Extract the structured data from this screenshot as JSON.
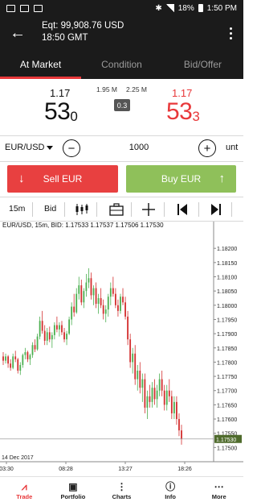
{
  "status_bar": {
    "battery": "18%",
    "time": "1:50 PM"
  },
  "account": {
    "equity": "Eqt: 99,908.76 USD",
    "time": "18:50 GMT"
  },
  "tabs": [
    {
      "label": "At Market",
      "active": true
    },
    {
      "label": "Condition",
      "active": false
    },
    {
      "label": "Bid/Offer",
      "active": false
    }
  ],
  "quote": {
    "bid_big": "1.17",
    "bid_pips": "53",
    "bid_fraction": "0",
    "ask_big": "1.17",
    "ask_pips": "53",
    "ask_fraction": "3",
    "bid_volume": "1.95 M",
    "ask_volume": "2.25 M",
    "spread": "0.3"
  },
  "order": {
    "symbol": "EUR/USD",
    "quantity": "1000",
    "unit": "unt",
    "minus": "−",
    "plus": "+"
  },
  "buttons": {
    "sell": "Sell EUR",
    "buy": "Buy EUR",
    "sell_arrow": "↓",
    "buy_arrow": "↑"
  },
  "toolbar": {
    "timeframe": "15m",
    "price_side": "Bid",
    "icons": [
      "candles-icon",
      "briefcase-icon",
      "crosshair-icon",
      "skip-back-icon",
      "skip-forward-icon"
    ]
  },
  "chart_data": {
    "type": "candlestick",
    "title": "EUR/USD, 15m, BID: 1.17533 1.17537 1.17506 1.17530",
    "ylim": [
      1.1745,
      1.1826
    ],
    "y_ticks": [
      "1.18200",
      "1.18150",
      "1.18100",
      "1.18050",
      "1.18000",
      "1.17950",
      "1.17900",
      "1.17850",
      "1.17800",
      "1.17750",
      "1.17700",
      "1.17650",
      "1.17600",
      "1.17550",
      "1.17500"
    ],
    "x_ticks": [
      "03:30",
      "08:28",
      "13:27",
      "18:26"
    ],
    "date_label": "14 Dec 2017",
    "last_price": "1.17530",
    "up_color": "#4caf50",
    "down_color": "#d32f2f",
    "candles": [
      [
        1.1782,
        1.17835,
        1.1779,
        1.17805
      ],
      [
        1.17805,
        1.1783,
        1.17795,
        1.1782
      ],
      [
        1.1782,
        1.17825,
        1.1778,
        1.17795
      ],
      [
        1.17795,
        1.1781,
        1.1777,
        1.1778
      ],
      [
        1.1778,
        1.1783,
        1.17775,
        1.1782
      ],
      [
        1.1782,
        1.1784,
        1.178,
        1.1781
      ],
      [
        1.1781,
        1.17815,
        1.1776,
        1.1777
      ],
      [
        1.1777,
        1.178,
        1.17755,
        1.1779
      ],
      [
        1.1779,
        1.1783,
        1.1778,
        1.17825
      ],
      [
        1.17825,
        1.1785,
        1.1781,
        1.17835
      ],
      [
        1.17835,
        1.1784,
        1.178,
        1.1781
      ],
      [
        1.1781,
        1.1783,
        1.1779,
        1.17825
      ],
      [
        1.17825,
        1.1787,
        1.17815,
        1.1786
      ],
      [
        1.1786,
        1.1788,
        1.17835,
        1.17845
      ],
      [
        1.17845,
        1.179,
        1.1784,
        1.1789
      ],
      [
        1.1789,
        1.1796,
        1.1788,
        1.17945
      ],
      [
        1.17945,
        1.1798,
        1.179,
        1.1791
      ],
      [
        1.1791,
        1.1793,
        1.1786,
        1.17875
      ],
      [
        1.17875,
        1.1792,
        1.1786,
        1.17905
      ],
      [
        1.17905,
        1.17925,
        1.1787,
        1.1788
      ],
      [
        1.1788,
        1.17905,
        1.1785,
        1.17895
      ],
      [
        1.17895,
        1.1794,
        1.1788,
        1.1793
      ],
      [
        1.1793,
        1.1796,
        1.17905,
        1.17915
      ],
      [
        1.17915,
        1.1794,
        1.1789,
        1.1793
      ],
      [
        1.1793,
        1.17945,
        1.17895,
        1.17905
      ],
      [
        1.17905,
        1.1792,
        1.1787,
        1.1788
      ],
      [
        1.1788,
        1.1791,
        1.1786,
        1.179
      ],
      [
        1.179,
        1.1796,
        1.17895,
        1.1795
      ],
      [
        1.1795,
        1.1801,
        1.1793,
        1.17995
      ],
      [
        1.17995,
        1.1804,
        1.1796,
        1.17975
      ],
      [
        1.17975,
        1.1806,
        1.1797,
        1.1804
      ],
      [
        1.1804,
        1.181,
        1.1802,
        1.1807
      ],
      [
        1.1807,
        1.1809,
        1.18,
        1.1801
      ],
      [
        1.1801,
        1.1806,
        1.1799,
        1.1805
      ],
      [
        1.1805,
        1.1811,
        1.1803,
        1.1808
      ],
      [
        1.1808,
        1.1813,
        1.1806,
        1.18095
      ],
      [
        1.18095,
        1.18115,
        1.1802,
        1.18035
      ],
      [
        1.18035,
        1.1807,
        1.18,
        1.1806
      ],
      [
        1.1806,
        1.1808,
        1.1799,
        1.18005
      ],
      [
        1.18005,
        1.1804,
        1.1797,
        1.18025
      ],
      [
        1.18025,
        1.1806,
        1.1799,
        1.18
      ],
      [
        1.18,
        1.1802,
        1.1795,
        1.1797
      ],
      [
        1.1797,
        1.18,
        1.1794,
        1.17985
      ],
      [
        1.17985,
        1.1804,
        1.1796,
        1.1803
      ],
      [
        1.1803,
        1.1808,
        1.18,
        1.1806
      ],
      [
        1.1806,
        1.181,
        1.1803,
        1.1804
      ],
      [
        1.1804,
        1.1806,
        1.1799,
        1.18
      ],
      [
        1.18,
        1.1802,
        1.1796,
        1.1798
      ],
      [
        1.1798,
        1.1804,
        1.1797,
        1.1803
      ],
      [
        1.1803,
        1.1806,
        1.18,
        1.1801
      ],
      [
        1.1801,
        1.1803,
        1.1795,
        1.1796
      ],
      [
        1.1796,
        1.1798,
        1.1786,
        1.1788
      ],
      [
        1.1788,
        1.179,
        1.1778,
        1.178
      ],
      [
        1.178,
        1.1785,
        1.1776,
        1.1783
      ],
      [
        1.1783,
        1.1786,
        1.1772,
        1.1774
      ],
      [
        1.1774,
        1.1779,
        1.177,
        1.1777
      ],
      [
        1.1777,
        1.178,
        1.1769,
        1.1771
      ],
      [
        1.1771,
        1.1776,
        1.1766,
        1.1774
      ],
      [
        1.1774,
        1.1776,
        1.1762,
        1.1764
      ],
      [
        1.1764,
        1.177,
        1.176,
        1.1768
      ],
      [
        1.1768,
        1.1772,
        1.1764,
        1.1766
      ],
      [
        1.1766,
        1.1773,
        1.1764,
        1.1771
      ],
      [
        1.1771,
        1.1774,
        1.1765,
        1.1767
      ],
      [
        1.1767,
        1.1772,
        1.1764,
        1.177
      ],
      [
        1.177,
        1.1776,
        1.1768,
        1.1774
      ],
      [
        1.1774,
        1.1777,
        1.1768,
        1.177
      ],
      [
        1.177,
        1.1772,
        1.1763,
        1.1765
      ],
      [
        1.1765,
        1.1772,
        1.1763,
        1.177
      ],
      [
        1.177,
        1.1774,
        1.1766,
        1.1768
      ],
      [
        1.1768,
        1.177,
        1.176,
        1.1762
      ],
      [
        1.1762,
        1.1768,
        1.176,
        1.1766
      ],
      [
        1.1766,
        1.1768,
        1.1758,
        1.176
      ],
      [
        1.176,
        1.1762,
        1.1754,
        1.1756
      ],
      [
        1.1756,
        1.1758,
        1.1751,
        1.1753
      ]
    ]
  },
  "bottom_nav": [
    {
      "label": "Trade",
      "icon": "trade-icon",
      "active": true
    },
    {
      "label": "Portfolio",
      "icon": "portfolio-icon",
      "active": false
    },
    {
      "label": "Charts",
      "icon": "charts-icon",
      "active": false
    },
    {
      "label": "Info",
      "icon": "info-icon",
      "active": false
    },
    {
      "label": "More",
      "icon": "more-icon",
      "active": false
    }
  ]
}
